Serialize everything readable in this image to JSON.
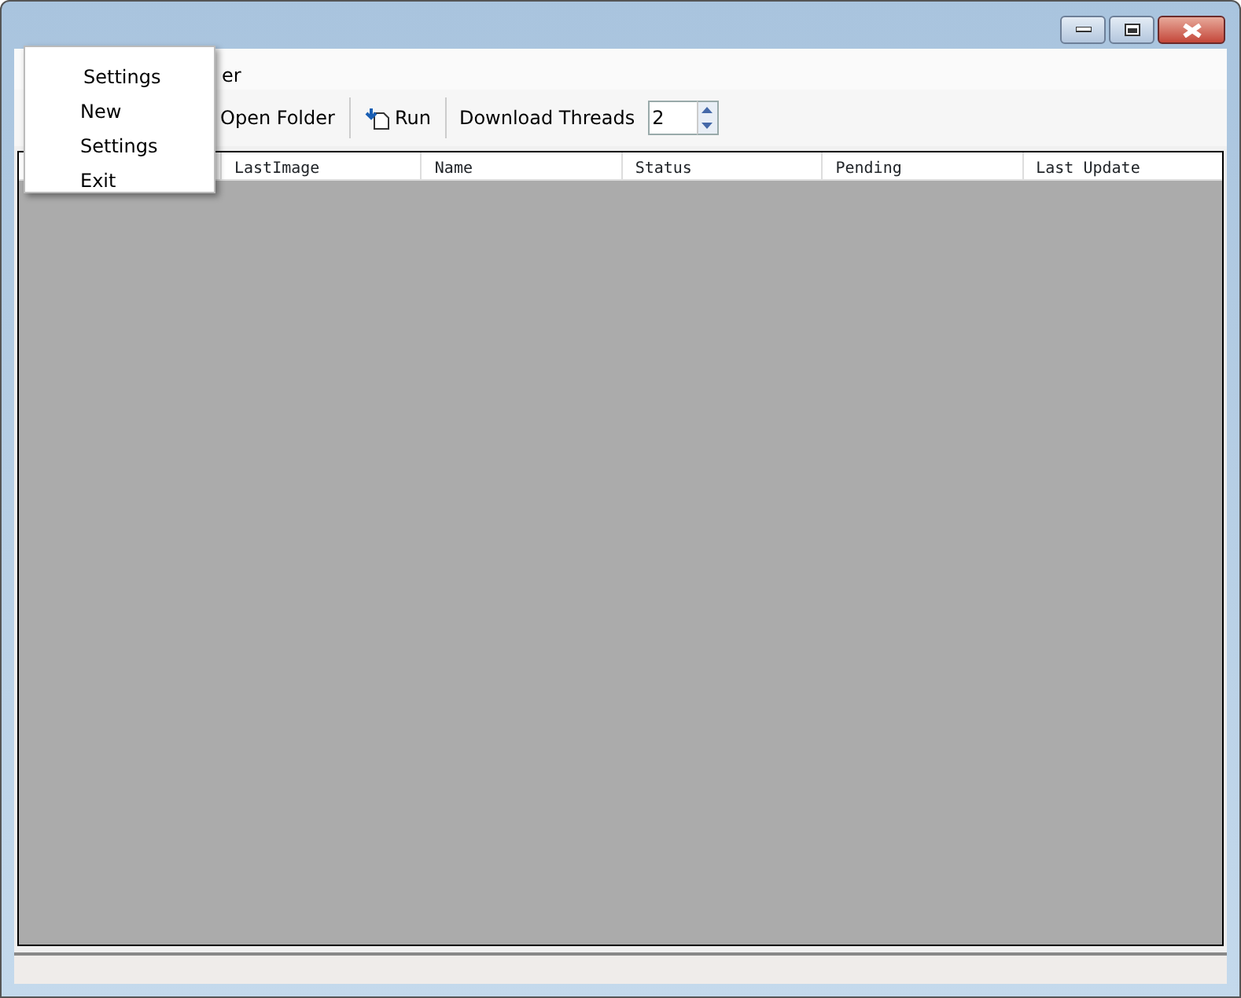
{
  "window": {
    "buttons": [
      {
        "kind": "minimize"
      },
      {
        "kind": "maximize"
      },
      {
        "kind": "close"
      }
    ]
  },
  "menu_bar": {
    "items": [
      "er"
    ]
  },
  "popup_menu": {
    "header": "Settings",
    "items": [
      "New",
      "Settings",
      "Exit"
    ]
  },
  "toolbar": {
    "items": [
      {
        "kind": "button",
        "label": "Open Folder"
      },
      {
        "kind": "button",
        "label": "Run"
      },
      {
        "kind": "label",
        "label": "Download Threads"
      }
    ],
    "spinner": {
      "value": "2"
    }
  },
  "table": {
    "columns": [
      "LastImage",
      "Name",
      "Status",
      "Pending",
      "Last Update"
    ]
  }
}
